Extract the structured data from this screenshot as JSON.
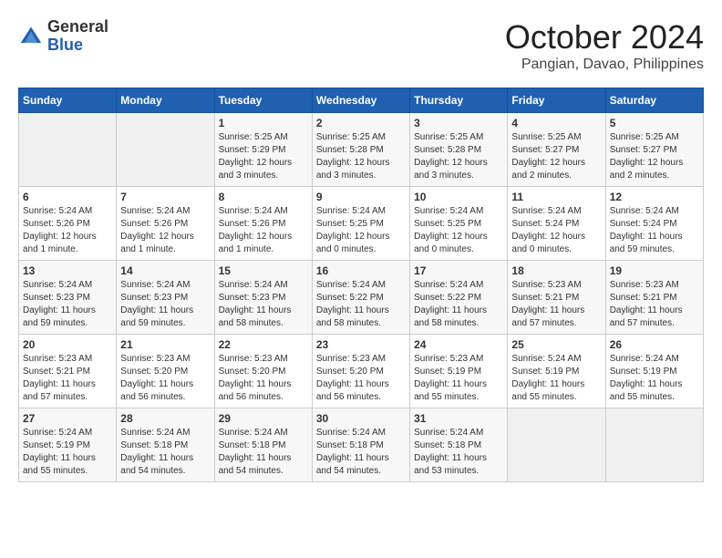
{
  "logo": {
    "general": "General",
    "blue": "Blue"
  },
  "title": {
    "month": "October 2024",
    "location": "Pangian, Davao, Philippines"
  },
  "weekdays": [
    "Sunday",
    "Monday",
    "Tuesday",
    "Wednesday",
    "Thursday",
    "Friday",
    "Saturday"
  ],
  "weeks": [
    [
      {
        "day": "",
        "sunrise": "",
        "sunset": "",
        "daylight": ""
      },
      {
        "day": "",
        "sunrise": "",
        "sunset": "",
        "daylight": ""
      },
      {
        "day": "1",
        "sunrise": "Sunrise: 5:25 AM",
        "sunset": "Sunset: 5:29 PM",
        "daylight": "Daylight: 12 hours and 3 minutes."
      },
      {
        "day": "2",
        "sunrise": "Sunrise: 5:25 AM",
        "sunset": "Sunset: 5:28 PM",
        "daylight": "Daylight: 12 hours and 3 minutes."
      },
      {
        "day": "3",
        "sunrise": "Sunrise: 5:25 AM",
        "sunset": "Sunset: 5:28 PM",
        "daylight": "Daylight: 12 hours and 3 minutes."
      },
      {
        "day": "4",
        "sunrise": "Sunrise: 5:25 AM",
        "sunset": "Sunset: 5:27 PM",
        "daylight": "Daylight: 12 hours and 2 minutes."
      },
      {
        "day": "5",
        "sunrise": "Sunrise: 5:25 AM",
        "sunset": "Sunset: 5:27 PM",
        "daylight": "Daylight: 12 hours and 2 minutes."
      }
    ],
    [
      {
        "day": "6",
        "sunrise": "Sunrise: 5:24 AM",
        "sunset": "Sunset: 5:26 PM",
        "daylight": "Daylight: 12 hours and 1 minute."
      },
      {
        "day": "7",
        "sunrise": "Sunrise: 5:24 AM",
        "sunset": "Sunset: 5:26 PM",
        "daylight": "Daylight: 12 hours and 1 minute."
      },
      {
        "day": "8",
        "sunrise": "Sunrise: 5:24 AM",
        "sunset": "Sunset: 5:26 PM",
        "daylight": "Daylight: 12 hours and 1 minute."
      },
      {
        "day": "9",
        "sunrise": "Sunrise: 5:24 AM",
        "sunset": "Sunset: 5:25 PM",
        "daylight": "Daylight: 12 hours and 0 minutes."
      },
      {
        "day": "10",
        "sunrise": "Sunrise: 5:24 AM",
        "sunset": "Sunset: 5:25 PM",
        "daylight": "Daylight: 12 hours and 0 minutes."
      },
      {
        "day": "11",
        "sunrise": "Sunrise: 5:24 AM",
        "sunset": "Sunset: 5:24 PM",
        "daylight": "Daylight: 12 hours and 0 minutes."
      },
      {
        "day": "12",
        "sunrise": "Sunrise: 5:24 AM",
        "sunset": "Sunset: 5:24 PM",
        "daylight": "Daylight: 11 hours and 59 minutes."
      }
    ],
    [
      {
        "day": "13",
        "sunrise": "Sunrise: 5:24 AM",
        "sunset": "Sunset: 5:23 PM",
        "daylight": "Daylight: 11 hours and 59 minutes."
      },
      {
        "day": "14",
        "sunrise": "Sunrise: 5:24 AM",
        "sunset": "Sunset: 5:23 PM",
        "daylight": "Daylight: 11 hours and 59 minutes."
      },
      {
        "day": "15",
        "sunrise": "Sunrise: 5:24 AM",
        "sunset": "Sunset: 5:23 PM",
        "daylight": "Daylight: 11 hours and 58 minutes."
      },
      {
        "day": "16",
        "sunrise": "Sunrise: 5:24 AM",
        "sunset": "Sunset: 5:22 PM",
        "daylight": "Daylight: 11 hours and 58 minutes."
      },
      {
        "day": "17",
        "sunrise": "Sunrise: 5:24 AM",
        "sunset": "Sunset: 5:22 PM",
        "daylight": "Daylight: 11 hours and 58 minutes."
      },
      {
        "day": "18",
        "sunrise": "Sunrise: 5:23 AM",
        "sunset": "Sunset: 5:21 PM",
        "daylight": "Daylight: 11 hours and 57 minutes."
      },
      {
        "day": "19",
        "sunrise": "Sunrise: 5:23 AM",
        "sunset": "Sunset: 5:21 PM",
        "daylight": "Daylight: 11 hours and 57 minutes."
      }
    ],
    [
      {
        "day": "20",
        "sunrise": "Sunrise: 5:23 AM",
        "sunset": "Sunset: 5:21 PM",
        "daylight": "Daylight: 11 hours and 57 minutes."
      },
      {
        "day": "21",
        "sunrise": "Sunrise: 5:23 AM",
        "sunset": "Sunset: 5:20 PM",
        "daylight": "Daylight: 11 hours and 56 minutes."
      },
      {
        "day": "22",
        "sunrise": "Sunrise: 5:23 AM",
        "sunset": "Sunset: 5:20 PM",
        "daylight": "Daylight: 11 hours and 56 minutes."
      },
      {
        "day": "23",
        "sunrise": "Sunrise: 5:23 AM",
        "sunset": "Sunset: 5:20 PM",
        "daylight": "Daylight: 11 hours and 56 minutes."
      },
      {
        "day": "24",
        "sunrise": "Sunrise: 5:23 AM",
        "sunset": "Sunset: 5:19 PM",
        "daylight": "Daylight: 11 hours and 55 minutes."
      },
      {
        "day": "25",
        "sunrise": "Sunrise: 5:24 AM",
        "sunset": "Sunset: 5:19 PM",
        "daylight": "Daylight: 11 hours and 55 minutes."
      },
      {
        "day": "26",
        "sunrise": "Sunrise: 5:24 AM",
        "sunset": "Sunset: 5:19 PM",
        "daylight": "Daylight: 11 hours and 55 minutes."
      }
    ],
    [
      {
        "day": "27",
        "sunrise": "Sunrise: 5:24 AM",
        "sunset": "Sunset: 5:19 PM",
        "daylight": "Daylight: 11 hours and 55 minutes."
      },
      {
        "day": "28",
        "sunrise": "Sunrise: 5:24 AM",
        "sunset": "Sunset: 5:18 PM",
        "daylight": "Daylight: 11 hours and 54 minutes."
      },
      {
        "day": "29",
        "sunrise": "Sunrise: 5:24 AM",
        "sunset": "Sunset: 5:18 PM",
        "daylight": "Daylight: 11 hours and 54 minutes."
      },
      {
        "day": "30",
        "sunrise": "Sunrise: 5:24 AM",
        "sunset": "Sunset: 5:18 PM",
        "daylight": "Daylight: 11 hours and 54 minutes."
      },
      {
        "day": "31",
        "sunrise": "Sunrise: 5:24 AM",
        "sunset": "Sunset: 5:18 PM",
        "daylight": "Daylight: 11 hours and 53 minutes."
      },
      {
        "day": "",
        "sunrise": "",
        "sunset": "",
        "daylight": ""
      },
      {
        "day": "",
        "sunrise": "",
        "sunset": "",
        "daylight": ""
      }
    ]
  ]
}
